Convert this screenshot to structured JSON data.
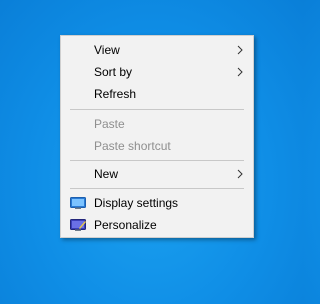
{
  "context_menu": {
    "items": [
      {
        "label": "View",
        "has_submenu": true
      },
      {
        "label": "Sort by",
        "has_submenu": true
      },
      {
        "label": "Refresh"
      },
      {
        "label": "Paste",
        "disabled": true
      },
      {
        "label": "Paste shortcut",
        "disabled": true
      },
      {
        "label": "New",
        "has_submenu": true
      },
      {
        "label": "Display settings",
        "icon": "display-icon"
      },
      {
        "label": "Personalize",
        "icon": "personalize-icon"
      }
    ]
  },
  "colors": {
    "desktop": "#1294e8",
    "menu_bg": "#f2f2f2",
    "disabled_text": "#8f8f8f"
  }
}
